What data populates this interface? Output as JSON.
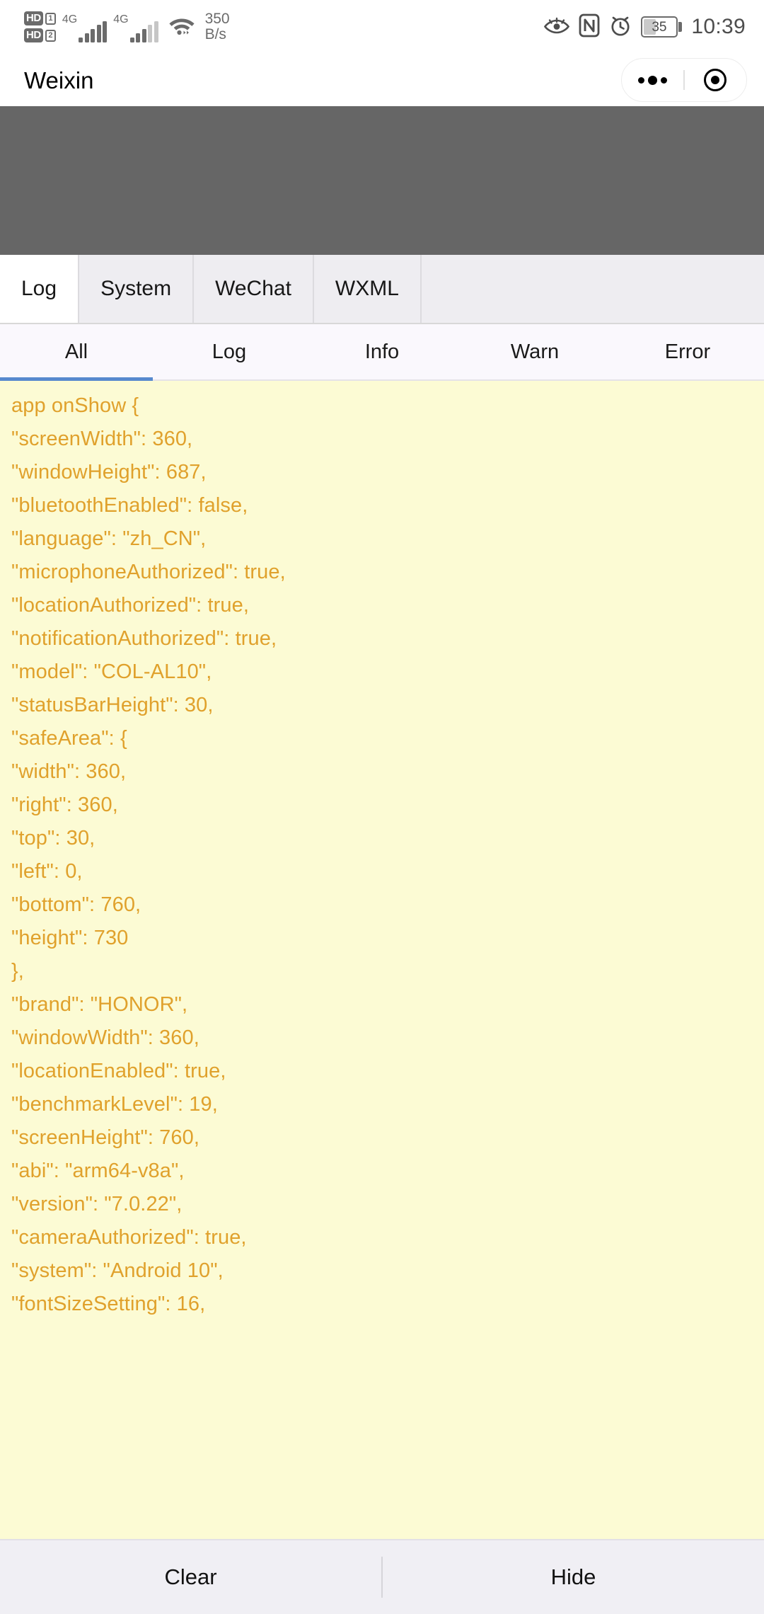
{
  "status_bar": {
    "hd_label_1": "HD",
    "sim_1": "1",
    "hd_label_2": "HD",
    "sim_2": "2",
    "network_1": "4G",
    "network_2": "4G",
    "net_speed_value": "350",
    "net_speed_unit": "B/s",
    "battery_percent": "35",
    "time": "10:39",
    "icons": [
      "eye-comfort-icon",
      "nfc-icon",
      "alarm-icon",
      "battery-icon"
    ]
  },
  "nav_bar": {
    "title": "Weixin",
    "menu_icon": "more-dots-icon",
    "close_icon": "target-circle-icon"
  },
  "debug_panel": {
    "tabs": [
      {
        "label": "Log",
        "active": true
      },
      {
        "label": "System",
        "active": false
      },
      {
        "label": "WeChat",
        "active": false
      },
      {
        "label": "WXML",
        "active": false
      },
      {
        "label": "",
        "active": false
      }
    ],
    "filters": [
      {
        "label": "All",
        "active": true
      },
      {
        "label": "Log",
        "active": false
      },
      {
        "label": "Info",
        "active": false
      },
      {
        "label": "Warn",
        "active": false
      },
      {
        "label": "Error",
        "active": false
      }
    ],
    "log_color": "#e0a12c",
    "log_background": "#fcfbd4",
    "log_lines": [
      "app onShow {",
      "\"screenWidth\": 360,",
      "\"windowHeight\": 687,",
      "\"bluetoothEnabled\": false,",
      "\"language\": \"zh_CN\",",
      "\"microphoneAuthorized\": true,",
      "\"locationAuthorized\": true,",
      "\"notificationAuthorized\": true,",
      "\"model\": \"COL-AL10\",",
      "\"statusBarHeight\": 30,",
      "\"safeArea\": {",
      "\"width\": 360,",
      "\"right\": 360,",
      "\"top\": 30,",
      "\"left\": 0,",
      "\"bottom\": 760,",
      "\"height\": 730",
      "},",
      "\"brand\": \"HONOR\",",
      "\"windowWidth\": 360,",
      "\"locationEnabled\": true,",
      "\"benchmarkLevel\": 19,",
      "\"screenHeight\": 760,",
      "\"abi\": \"arm64-v8a\",",
      "\"version\": \"7.0.22\",",
      "\"cameraAuthorized\": true,",
      "\"system\": \"Android 10\",",
      "\"fontSizeSetting\": 16,"
    ],
    "actions": [
      {
        "label": "Clear"
      },
      {
        "label": "Hide"
      }
    ]
  }
}
